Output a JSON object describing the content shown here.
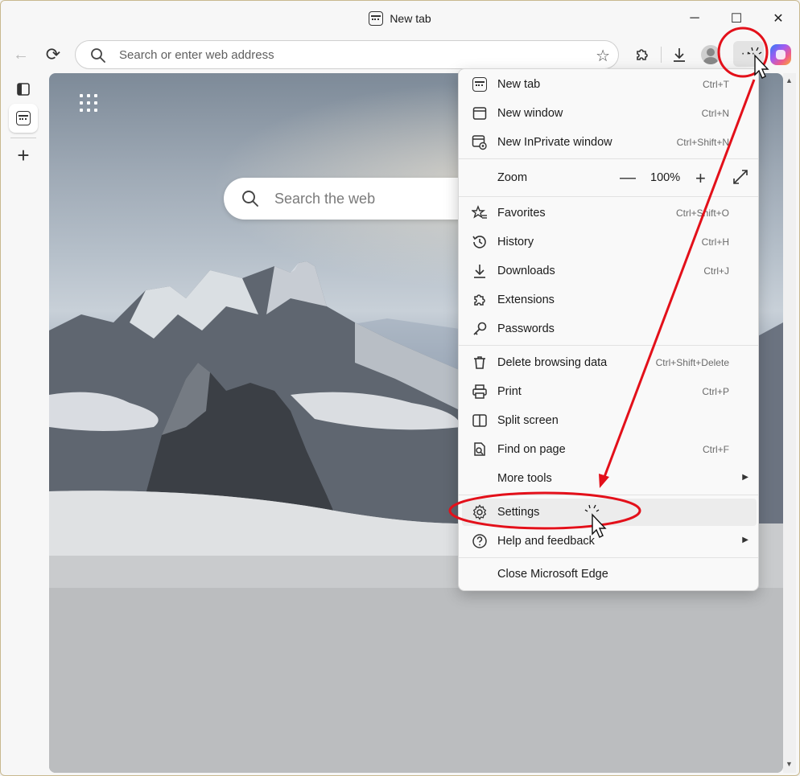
{
  "window": {
    "tab_title": "New tab",
    "controls": {
      "minimize": "─",
      "maximize": "☐",
      "close": "✕"
    }
  },
  "toolbar": {
    "back_icon": "←",
    "refresh_icon": "⟳",
    "address_placeholder": "Search or enter web address",
    "more_label": "···"
  },
  "page": {
    "search_placeholder": "Search the web"
  },
  "menu": {
    "items": [
      {
        "label": "New tab",
        "shortcut": "Ctrl+T"
      },
      {
        "label": "New window",
        "shortcut": "Ctrl+N"
      },
      {
        "label": "New InPrivate window",
        "shortcut": "Ctrl+Shift+N"
      },
      {
        "label": "Zoom",
        "value": "100%"
      },
      {
        "label": "Favorites",
        "shortcut": "Ctrl+Shift+O"
      },
      {
        "label": "History",
        "shortcut": "Ctrl+H"
      },
      {
        "label": "Downloads",
        "shortcut": "Ctrl+J"
      },
      {
        "label": "Extensions",
        "shortcut": ""
      },
      {
        "label": "Passwords",
        "shortcut": ""
      },
      {
        "label": "Delete browsing data",
        "shortcut": "Ctrl+Shift+Delete"
      },
      {
        "label": "Print",
        "shortcut": "Ctrl+P"
      },
      {
        "label": "Split screen",
        "shortcut": ""
      },
      {
        "label": "Find on page",
        "shortcut": "Ctrl+F"
      },
      {
        "label": "More tools",
        "shortcut": ""
      },
      {
        "label": "Settings",
        "shortcut": ""
      },
      {
        "label": "Help and feedback",
        "shortcut": ""
      },
      {
        "label": "Close Microsoft Edge",
        "shortcut": ""
      }
    ]
  },
  "colors": {
    "annotation": "#e3101a",
    "menu_bg": "#f9f9f9",
    "highlight_bg": "#ececec"
  }
}
